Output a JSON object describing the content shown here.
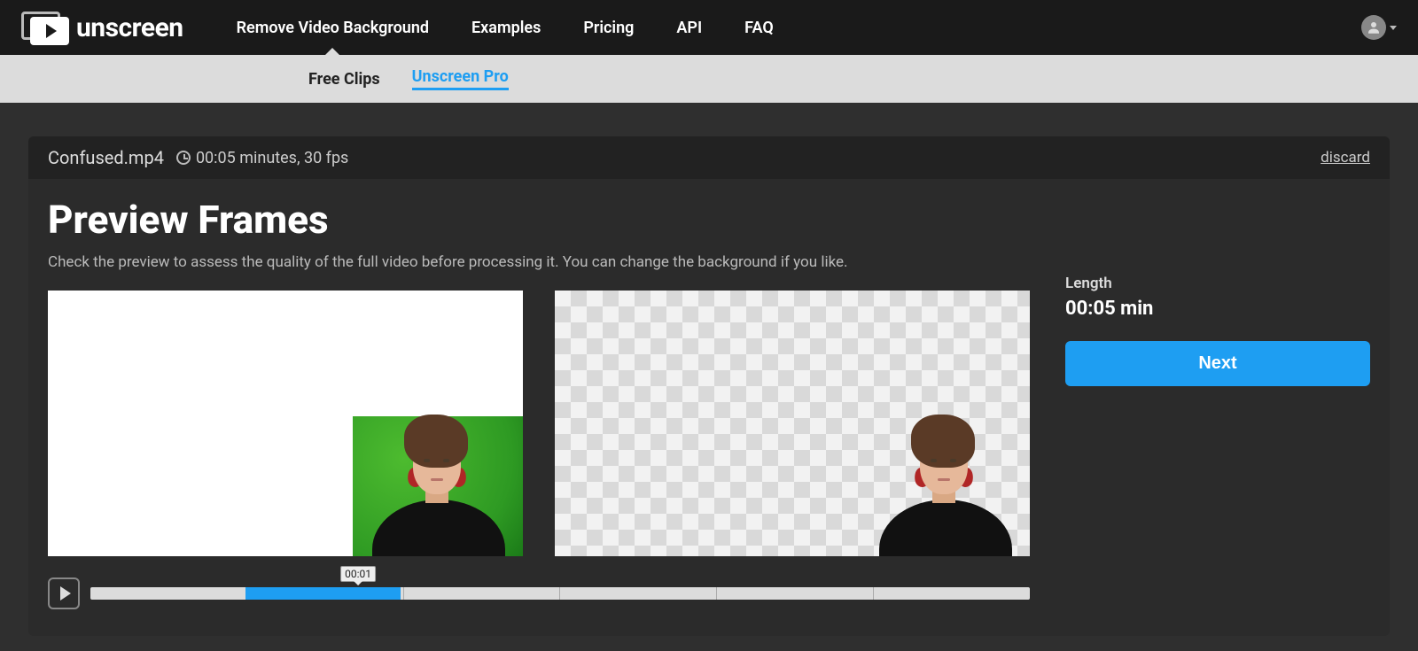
{
  "brand": "unscreen",
  "nav": {
    "items": [
      {
        "label": "Remove Video Background",
        "active": true
      },
      {
        "label": "Examples"
      },
      {
        "label": "Pricing"
      },
      {
        "label": "API"
      },
      {
        "label": "FAQ"
      }
    ]
  },
  "subnav": {
    "tabs": [
      {
        "label": "Free Clips",
        "active": false
      },
      {
        "label": "Unscreen Pro",
        "active": true
      }
    ]
  },
  "file": {
    "name": "Confused.mp4",
    "meta": "00:05 minutes, 30 fps"
  },
  "actions": {
    "discard": "discard",
    "next": "Next"
  },
  "page": {
    "title": "Preview Frames",
    "subtitle": "Check the preview to assess the quality of the full video before processing it. You can change the background if you like."
  },
  "sidebar": {
    "length_label": "Length",
    "length_value": "00:05 min"
  },
  "timeline": {
    "marker": "00:01",
    "segments": 6,
    "fill_start_pct": 16.5,
    "fill_width_pct": 16.5
  }
}
